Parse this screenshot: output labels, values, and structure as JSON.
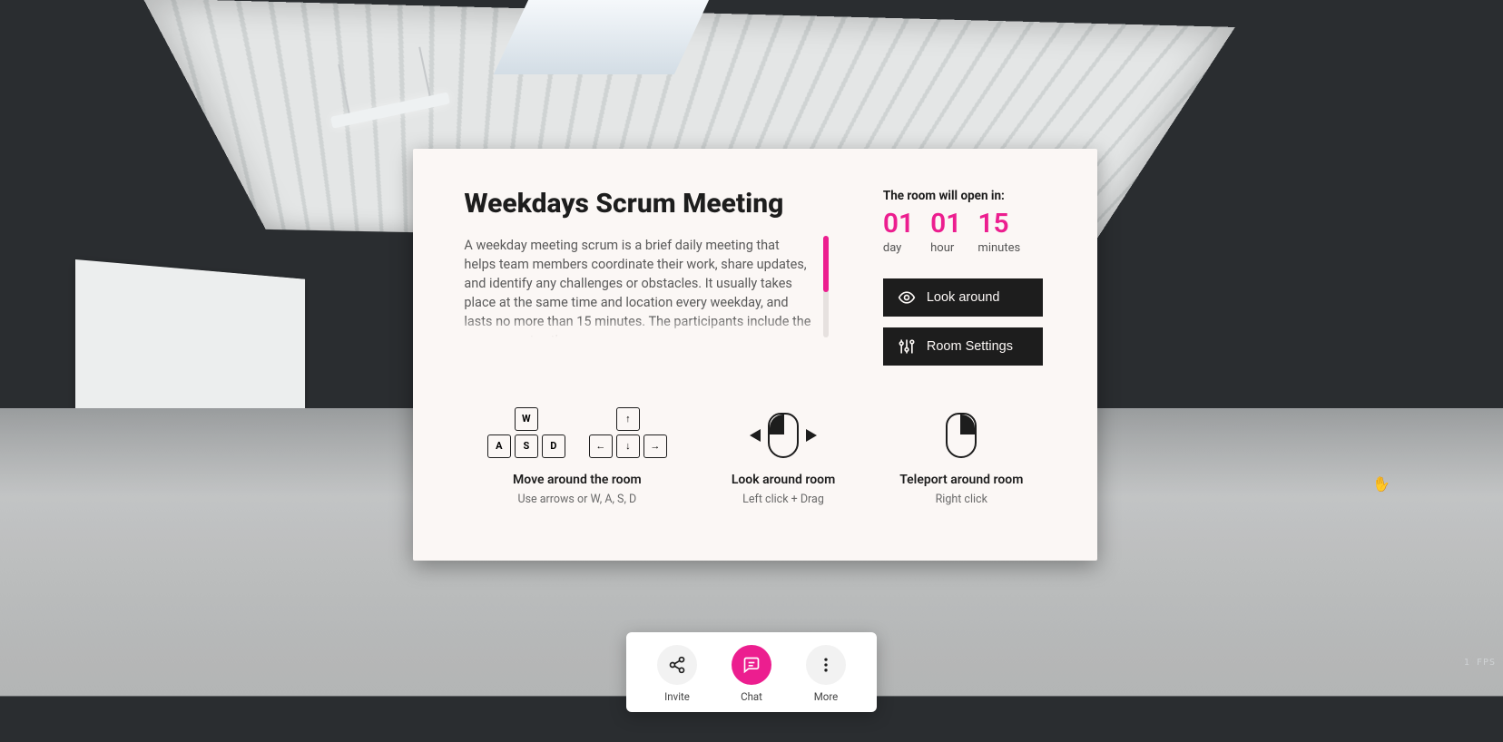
{
  "meeting": {
    "title": "Weekdays Scrum Meeting",
    "description": "A weekday meeting scrum is a brief daily meeting that helps team members coordinate their work, share updates, and identify any challenges or obstacles. It usually takes place at the same time and location every weekday, and lasts no more than 15 minutes. The participants include the scrum master, the"
  },
  "countdown": {
    "label": "The room will open in:",
    "day": {
      "value": "01",
      "unit": "day"
    },
    "hour": {
      "value": "01",
      "unit": "hour"
    },
    "min": {
      "value": "15",
      "unit": "minutes"
    }
  },
  "actions": {
    "look_around": "Look around",
    "room_settings": "Room Settings"
  },
  "guide": {
    "move": {
      "title": "Move around the room",
      "sub": "Use arrows or W, A, S, D"
    },
    "look": {
      "title": "Look around room",
      "sub": "Left click + Drag"
    },
    "teleport": {
      "title": "Teleport around room",
      "sub": "Right click"
    },
    "keys": {
      "w": "W",
      "a": "A",
      "s": "S",
      "d": "D",
      "up": "↑",
      "left": "←",
      "down": "↓",
      "right": "→"
    }
  },
  "dock": {
    "invite": "Invite",
    "chat": "Chat",
    "more": "More"
  },
  "hud": {
    "fps": "1 FPS"
  },
  "colors": {
    "accent": "#ec1e8f",
    "panel": "#fbf7f5",
    "ink": "#1d1d1d"
  }
}
